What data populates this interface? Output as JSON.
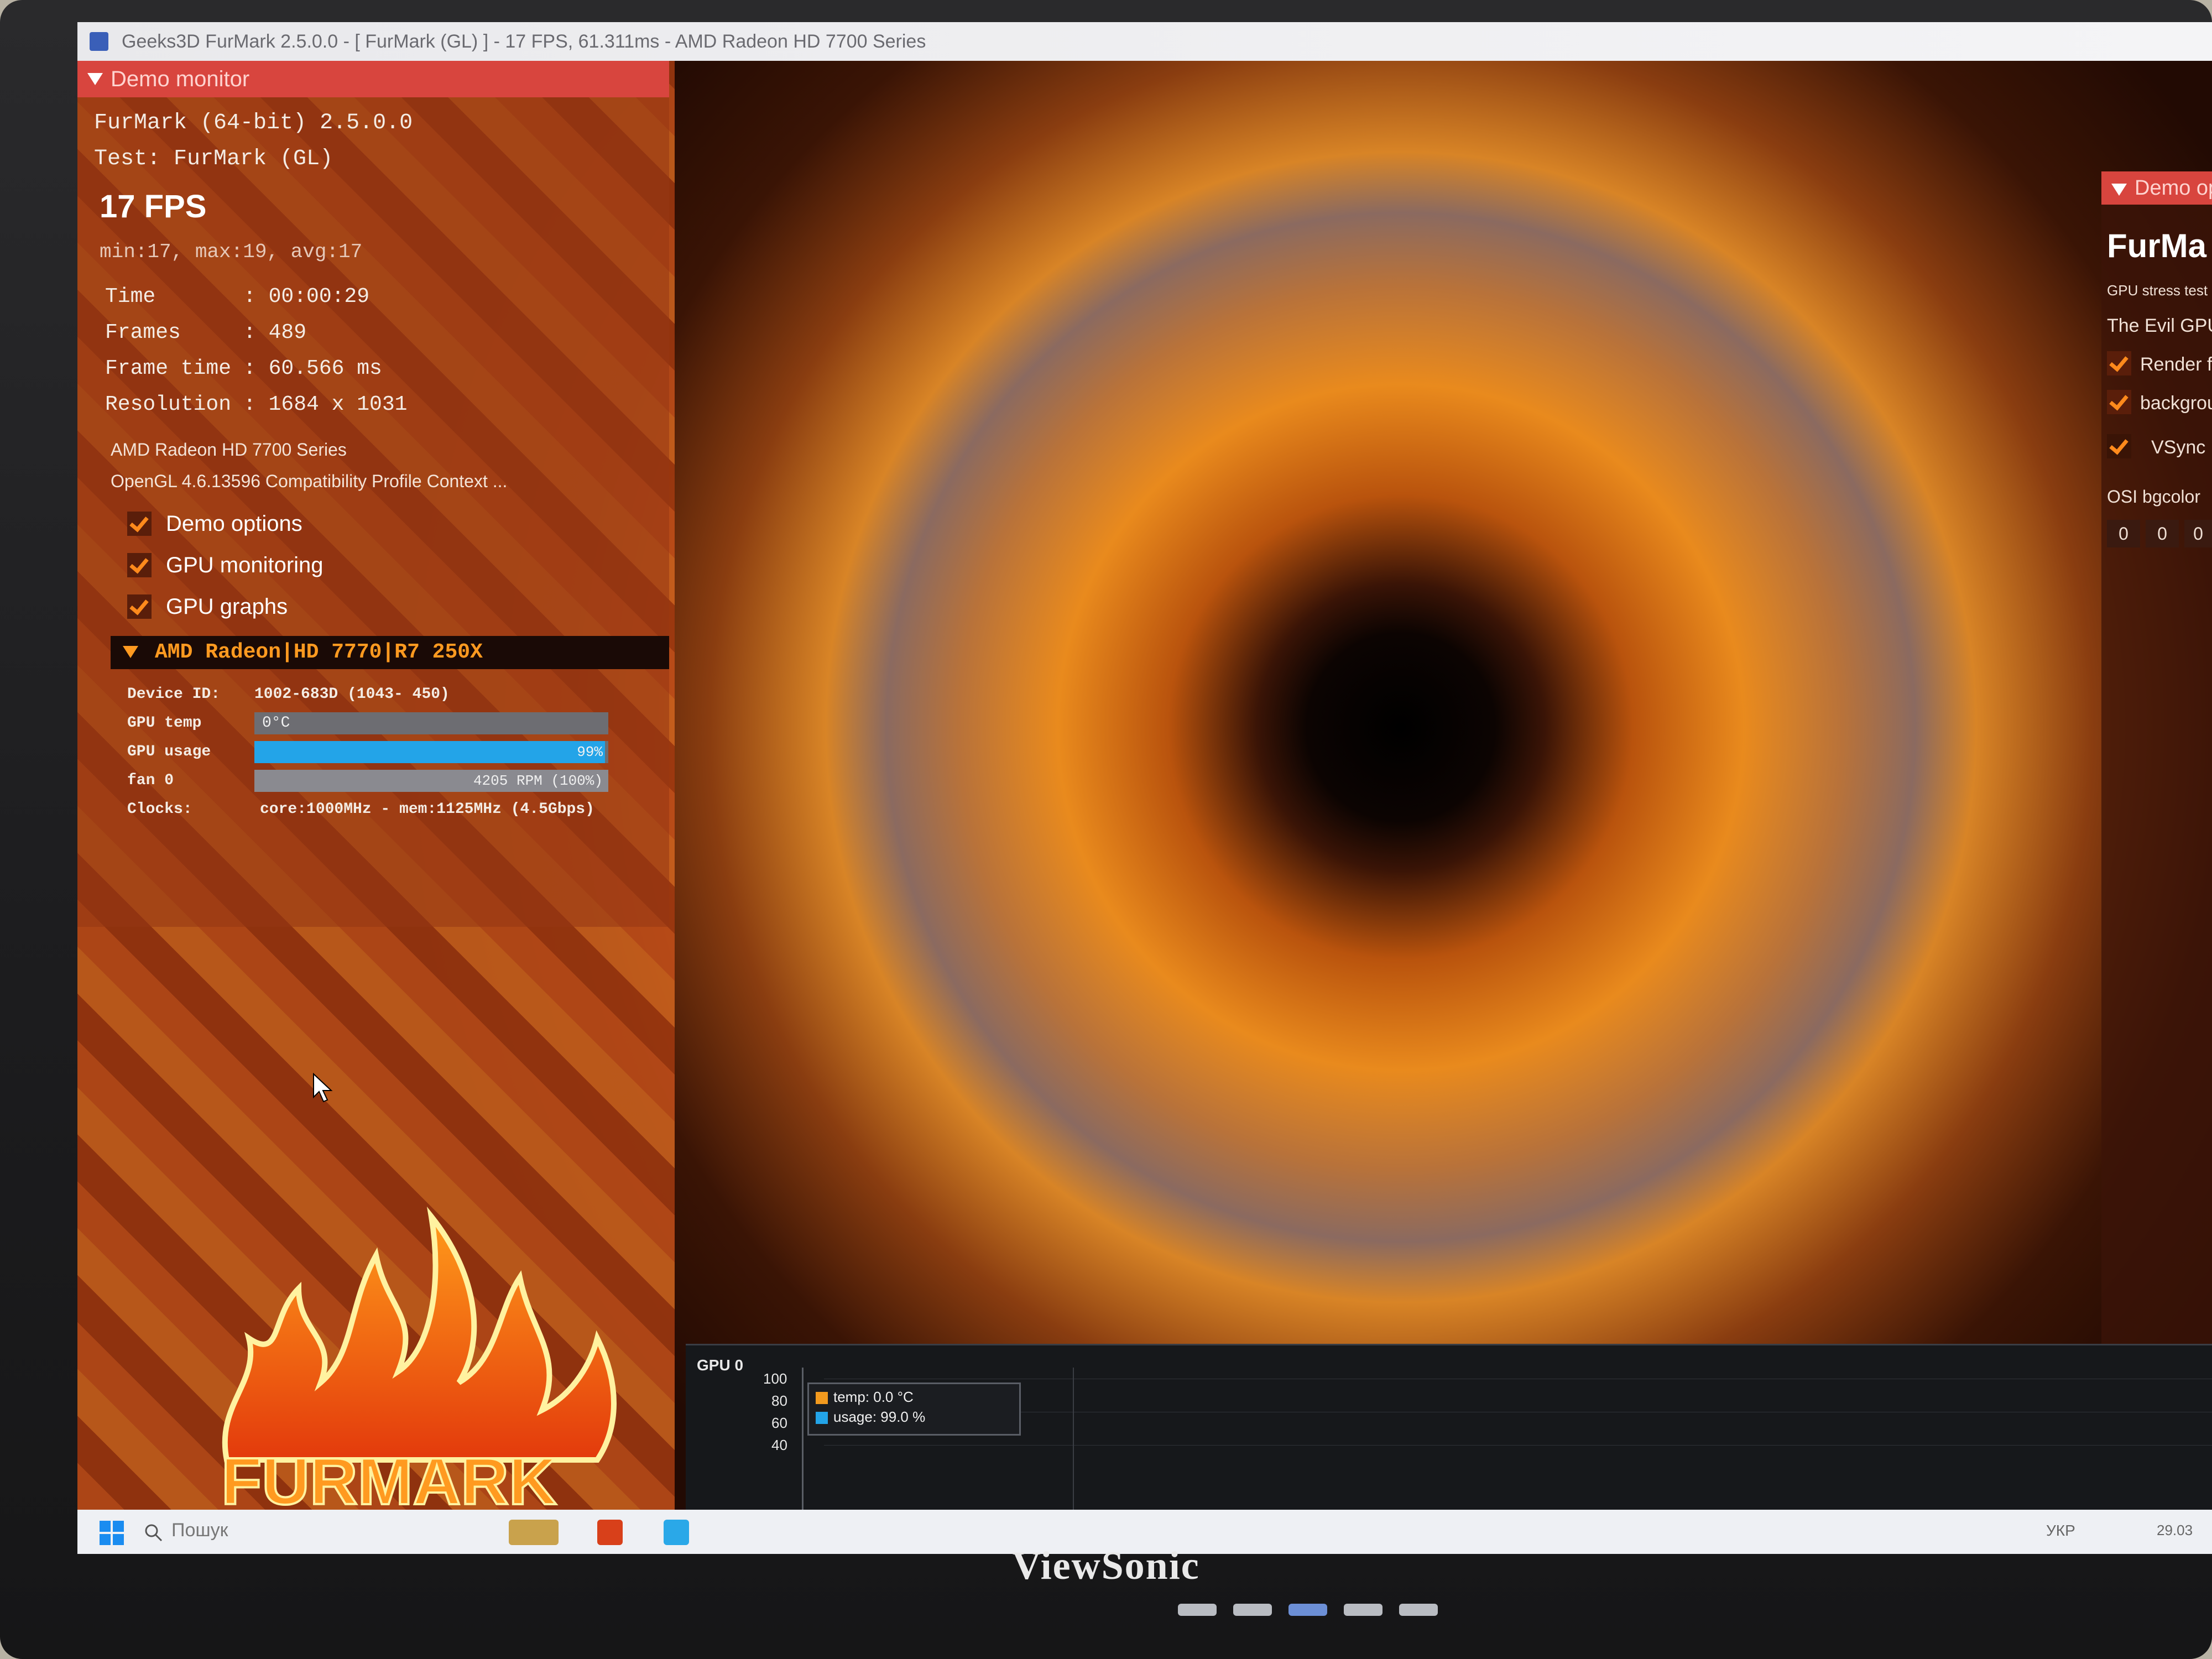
{
  "window": {
    "title": "Geeks3D FurMark 2.5.0.0 - [ FurMark (GL) ] - 17 FPS, 61.311ms - AMD Radeon HD 7700 Series"
  },
  "demo_monitor": {
    "header": "Demo monitor",
    "app_line": "FurMark (64-bit) 2.5.0.0",
    "test_line": "Test: FurMark (GL)",
    "fps": "17 FPS",
    "fps_stats": "min:17, max:19, avg:17",
    "time_label": "Time",
    "time_value": ": 00:00:29",
    "frames_label": "Frames",
    "frames_value": ": 489",
    "frametime_label": "Frame time",
    "frametime_value": ": 60.566 ms",
    "resolution_label": "Resolution",
    "resolution_value": ": 1684 x 1031",
    "gpu_name": "AMD Radeon HD 7700 Series",
    "opengl": "OpenGL 4.6.13596 Compatibility Profile Context ...",
    "checkboxes": [
      {
        "label": "Demo options",
        "checked": true
      },
      {
        "label": "GPU monitoring",
        "checked": true
      },
      {
        "label": "GPU graphs",
        "checked": true
      }
    ]
  },
  "gpu_section": {
    "header": "AMD Radeon|HD 7770|R7 250X",
    "device_id_label": "Device ID:",
    "device_id_value": "1002-683D (1043- 450)",
    "temp_label": "GPU temp",
    "temp_value": "0°C",
    "usage_label": "GPU usage",
    "usage_value": "99%",
    "usage_fraction": 0.99,
    "fan_label": "fan 0",
    "fan_value": "4205 RPM (100%)",
    "clocks_label": "Clocks:",
    "clocks_value": "core:1000MHz - mem:1125MHz (4.5Gbps)"
  },
  "logo_text": "FURMARK",
  "right_panel": {
    "header": "Demo op",
    "title": "FurMa",
    "subtitle": "GPU stress test -",
    "evil": "The Evil GPU",
    "opt1": "Render fur",
    "opt2": "backgroun",
    "vsync": "VSync",
    "osi": "OSI bgcolor",
    "vals": [
      "0",
      "0",
      "0"
    ]
  },
  "graph": {
    "label": "GPU 0",
    "ticks": [
      "100",
      "80",
      "60",
      "40"
    ],
    "legend_temp": "temp: 0.0 °C",
    "legend_usage": "usage: 99.0 %",
    "colors": {
      "temp": "#f39a1e",
      "usage": "#23a4e8"
    }
  },
  "taskbar": {
    "search_placeholder": "Пошук",
    "tray_lang": "УКР",
    "tray_date": "29.03"
  },
  "monitor_brand": "ViewSonic"
}
